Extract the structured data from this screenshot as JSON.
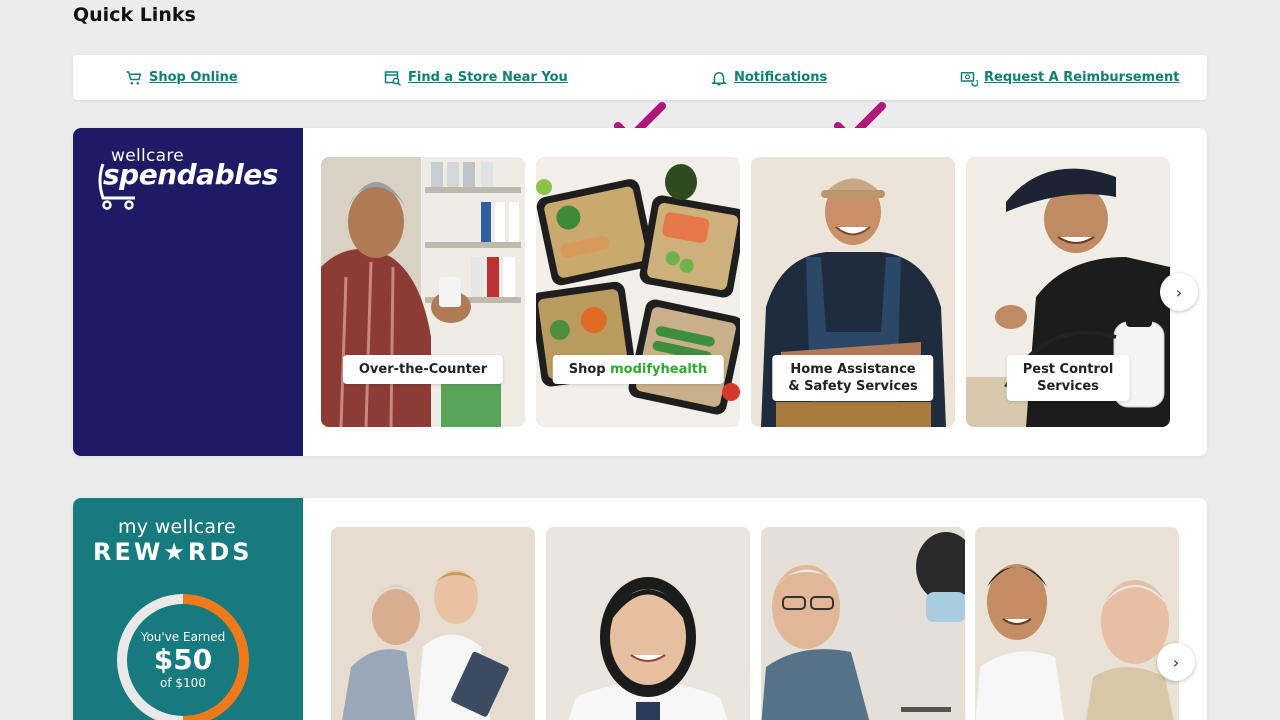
{
  "page": {
    "title": "Quick Links"
  },
  "quick_links": [
    {
      "label": "Shop Online",
      "icon": "cart-icon"
    },
    {
      "label": "Find a Store Near You",
      "icon": "store-search-icon"
    },
    {
      "label": "Notifications",
      "icon": "bell-icon"
    },
    {
      "label": "Request A Reimbursement",
      "icon": "money-icon"
    }
  ],
  "spendables": {
    "brand_small": "wellcare",
    "brand_big": "spendables",
    "brand_color": "#1e1b66",
    "tiles": [
      {
        "label": "Over-the-Counter"
      },
      {
        "label_prefix": "Shop",
        "label_brand": "modifyhealth"
      },
      {
        "label_line1": "Home Assistance",
        "label_line2": "& Safety Services"
      },
      {
        "label_line1": "Pest Control",
        "label_line2": "Services"
      }
    ],
    "checkmark_color": "#b0177a"
  },
  "rewards": {
    "brand_small": "my wellcare",
    "brand_big": "REW★RDS",
    "brand_color": "#177a7e",
    "ring_color": "#ef7a1a",
    "earned_label": "You've Earned",
    "earned_amount": "$50",
    "earned_of": "of $100",
    "progress": 0.5
  },
  "carousel": {
    "next_icon": "chevron-right-icon",
    "next_glyph": "›"
  }
}
